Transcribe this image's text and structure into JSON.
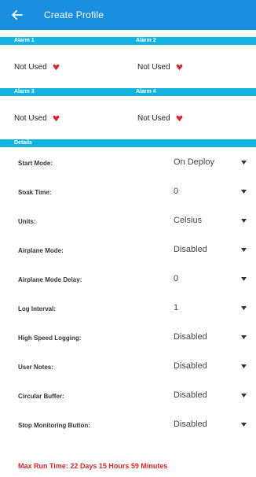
{
  "appbar": {
    "title": "Create Profile",
    "back_icon": "arrow-left-icon"
  },
  "alarms": {
    "header_1": [
      "Alarm 1",
      "Alarm 2"
    ],
    "header_2": [
      "Alarm 3",
      "Alarm 4"
    ],
    "values": [
      "Not Used",
      "Not Used",
      "Not Used",
      "Not Used"
    ]
  },
  "details": {
    "header": "Details",
    "settings": [
      {
        "label": "Start Mode:",
        "value": "On Deploy"
      },
      {
        "label": "Soak Time:",
        "value": "0"
      },
      {
        "label": "Units:",
        "value": "Celsius"
      },
      {
        "label": "Airplane Mode:",
        "value": "Disabled"
      },
      {
        "label": "Airplane Mode Delay:",
        "value": "0"
      },
      {
        "label": "Log Interval:",
        "value": "1"
      },
      {
        "label": "High Speed Logging:",
        "value": "Disabled"
      },
      {
        "label": "User Notes:",
        "value": "Disabled"
      },
      {
        "label": "Circular Buffer:",
        "value": "Disabled"
      },
      {
        "label": "Stop Monitoring Button:",
        "value": "Disabled"
      }
    ]
  },
  "max_run_time": "Max Run Time: 22 Days 15 Hours 59 Minutes",
  "colors": {
    "appbar": "#1a8fe0",
    "section": "#12b4df",
    "accent_red": "#d9262e"
  }
}
